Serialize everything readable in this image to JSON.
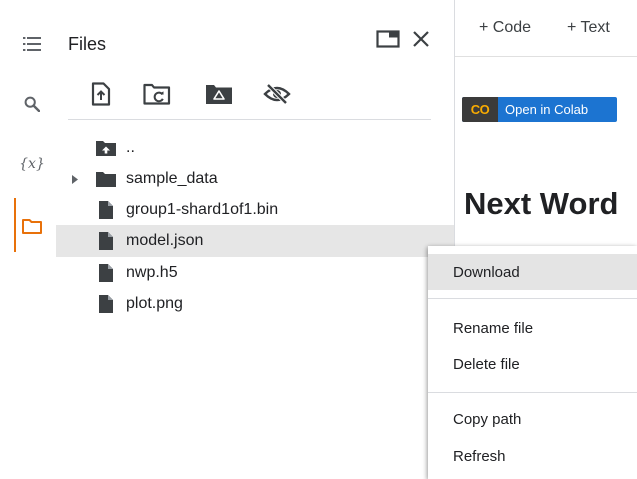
{
  "sidebar": {
    "items": [
      {
        "icon": "toc-icon"
      },
      {
        "icon": "search-icon"
      },
      {
        "icon": "variables-icon",
        "label": "{x}"
      },
      {
        "icon": "folder-icon",
        "active": true
      }
    ],
    "accent": "#e8710a"
  },
  "files_panel": {
    "title": "Files",
    "toolbar": [
      "upload-file-icon",
      "refresh-folder-icon",
      "mount-drive-icon",
      "hide-files-icon"
    ],
    "tree": [
      {
        "name": "..",
        "type": "parent"
      },
      {
        "name": "sample_data",
        "type": "folder"
      },
      {
        "name": "group1-shard1of1.bin",
        "type": "file"
      },
      {
        "name": "model.json",
        "type": "file",
        "selected": true
      },
      {
        "name": "nwp.h5",
        "type": "file"
      },
      {
        "name": "plot.png",
        "type": "file"
      }
    ]
  },
  "notebook": {
    "toolbar": {
      "code_label": "+ Code",
      "text_label": "+ Text"
    },
    "badge": {
      "logo": "CO",
      "text": "Open in Colab",
      "color": "#1c74d1"
    },
    "heading": "Next Word"
  },
  "context_menu": {
    "items": [
      {
        "label": "Download",
        "hover": true
      },
      {
        "label": "Rename file"
      },
      {
        "label": "Delete file"
      },
      {
        "label": "Copy path"
      },
      {
        "label": "Refresh"
      }
    ]
  }
}
